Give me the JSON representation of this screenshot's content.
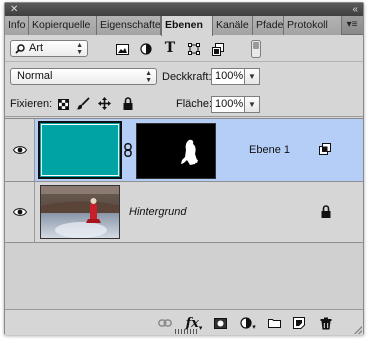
{
  "titlebar": {
    "close_glyph": "✕",
    "collapse_glyph": "«"
  },
  "tabs": [
    {
      "label": "Info",
      "active": false
    },
    {
      "label": "Kopierquelle",
      "active": false
    },
    {
      "label": "Eigenschaften",
      "active": false
    },
    {
      "label": "Ebenen",
      "active": true
    },
    {
      "label": "Kanäle",
      "active": false
    },
    {
      "label": "Pfade",
      "active": false
    },
    {
      "label": "Protokoll",
      "active": false
    }
  ],
  "panel_menu_glyph": "▾≡",
  "filter": {
    "kind_value": "Art",
    "kind_icon": "search-icon",
    "filter_icons": [
      "pixel-layer-filter-icon",
      "adjustment-layer-filter-icon",
      "type-layer-filter-icon",
      "shape-layer-filter-icon",
      "smart-object-filter-icon",
      "filter-toggle-switch"
    ]
  },
  "blend": {
    "mode_value": "Normal",
    "opacity_label": "Deckkraft:",
    "opacity_value": "100%"
  },
  "lock": {
    "label": "Fixieren:",
    "icons": [
      "lock-transparent-pixels-icon",
      "lock-image-pixels-icon",
      "lock-position-icon",
      "lock-all-icon"
    ],
    "fill_label": "Fläche:",
    "fill_value": "100%"
  },
  "layers": [
    {
      "name": "Ebene 1",
      "visible": true,
      "selected": true,
      "color_fill": "#00a3a4",
      "has_mask": true,
      "badge_icon": "link-layers-icon"
    },
    {
      "name": "Hintergrund",
      "visible": true,
      "selected": false,
      "italic": true,
      "locked": true,
      "badge_icon": "lock-icon"
    }
  ],
  "footer_icons": [
    "link-layers-icon",
    "fx-icon",
    "add-mask-icon",
    "new-adjustment-layer-icon",
    "new-group-icon",
    "new-layer-icon",
    "delete-layer-icon"
  ],
  "footer_fx_text": "fx",
  "colors": {
    "selection": "#b5cef8",
    "panel": "#d6d6d6",
    "fill": "#00a3a4"
  }
}
